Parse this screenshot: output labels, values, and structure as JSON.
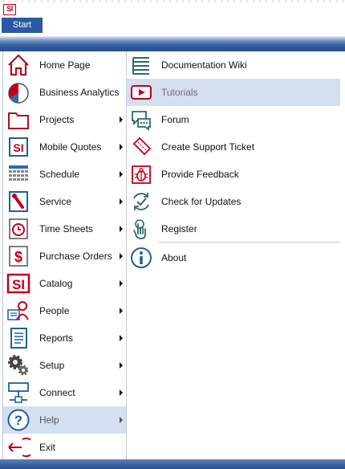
{
  "app": {
    "logo_text": "SI",
    "start_label": "Start"
  },
  "main_menu": {
    "items": [
      {
        "label": "Home Page",
        "icon": "home-icon",
        "has_submenu": false
      },
      {
        "label": "Business Analytics",
        "icon": "pie-chart-icon",
        "has_submenu": false
      },
      {
        "label": "Projects",
        "icon": "folder-icon",
        "has_submenu": true
      },
      {
        "label": "Mobile Quotes",
        "icon": "si-logo-icon",
        "has_submenu": true
      },
      {
        "label": "Schedule",
        "icon": "calendar-icon",
        "has_submenu": true
      },
      {
        "label": "Service",
        "icon": "wrench-icon",
        "has_submenu": true
      },
      {
        "label": "Time Sheets",
        "icon": "clock-icon",
        "has_submenu": true
      },
      {
        "label": "Purchase Orders",
        "icon": "dollar-icon",
        "has_submenu": true
      },
      {
        "label": "Catalog",
        "icon": "si-catalog-icon",
        "has_submenu": true
      },
      {
        "label": "People",
        "icon": "people-icon",
        "has_submenu": true
      },
      {
        "label": "Reports",
        "icon": "report-icon",
        "has_submenu": true
      },
      {
        "label": "Setup",
        "icon": "gears-icon",
        "has_submenu": true
      },
      {
        "label": "Connect",
        "icon": "network-icon",
        "has_submenu": true
      },
      {
        "label": "Help",
        "icon": "help-icon",
        "has_submenu": true,
        "active": true
      },
      {
        "label": "Exit",
        "icon": "exit-icon",
        "has_submenu": false
      }
    ]
  },
  "help_submenu": {
    "items": [
      {
        "label": "Documentation Wiki",
        "icon": "books-icon"
      },
      {
        "label": "Tutorials",
        "icon": "video-icon",
        "highlighted": true
      },
      {
        "label": "Forum",
        "icon": "chat-icon"
      },
      {
        "label": "Create Support Ticket",
        "icon": "ticket-icon"
      },
      {
        "label": "Provide Feedback",
        "icon": "bug-icon"
      },
      {
        "label": "Check for Updates",
        "icon": "update-icon"
      },
      {
        "label": "Register",
        "icon": "hand-icon"
      },
      {
        "label": "About",
        "icon": "info-icon"
      }
    ]
  },
  "colors": {
    "accent_red": "#c0001a",
    "start_blue": "#2a5aa3",
    "band_blue": "#2a4f8e",
    "highlight": "#d4dff0",
    "icon_teal": "#2b6b6a",
    "icon_blue": "#1f5f9e"
  }
}
